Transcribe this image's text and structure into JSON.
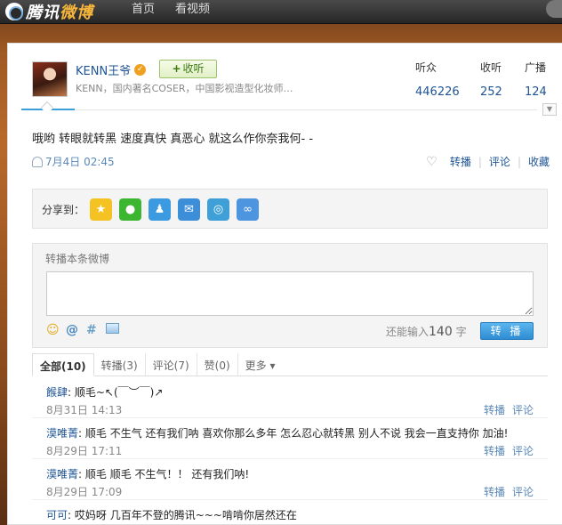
{
  "nav": {
    "logo_prefix": "腾讯",
    "logo_suffix": "微博",
    "home": "首页",
    "video": "看视频"
  },
  "profile": {
    "name": "KENN王爷",
    "verified_icon": "verified-badge-icon",
    "follow_label": "收听",
    "bio": "KENN，国内著名COSER，中国影视造型化妆师…",
    "stats": {
      "fans_label": "听众",
      "fans_value": "446226",
      "follow_label": "收听",
      "follow_value": "252",
      "broadcast_label": "广播",
      "broadcast_value": "124"
    }
  },
  "post": {
    "text": "哦哟 转眼就转黑 速度真快 真恶心 就这么作你奈我何- -",
    "time": "7月4日 02:45",
    "actions": {
      "repost": "转播",
      "comment": "评论",
      "favorite": "收藏"
    }
  },
  "share": {
    "label": "分享到：",
    "icons": [
      "qzone-icon",
      "wechat-icon",
      "qq-icon",
      "mail-icon",
      "pengyou-icon",
      "link-icon"
    ]
  },
  "repost_box": {
    "title": "转播本条微博",
    "counter_prefix": "还能输入",
    "counter_value": "140",
    "counter_suffix": "字",
    "submit": "转 播"
  },
  "tabs": {
    "all": "全部(10)",
    "repost": "转播(3)",
    "comment": "评论(7)",
    "like": "赞(0)",
    "more": "更多"
  },
  "comments": [
    {
      "author": "餱肆",
      "text": "顺毛~↖(￣︶￣)↗",
      "time": "8月31日 14:13",
      "repost": "转播",
      "comment": "评论"
    },
    {
      "author": "漠唯菁",
      "text": "顺毛 不生气 还有我们呐 喜欢你那么多年 怎么忍心就转黑 别人不说 我会一直支持你 加油!",
      "time": "8月29日 17:11",
      "repost": "转播",
      "comment": "评论"
    },
    {
      "author": "漠唯菁",
      "text": "顺毛 顺毛 不生气！！ 还有我们呐!",
      "time": "8月29日 17:09",
      "repost": "转播",
      "comment": "评论"
    },
    {
      "author": "可可",
      "text": "哎妈呀 几百年不登的腾讯~~~啃啃你居然还在",
      "time": "",
      "repost": "",
      "comment": ""
    }
  ]
}
